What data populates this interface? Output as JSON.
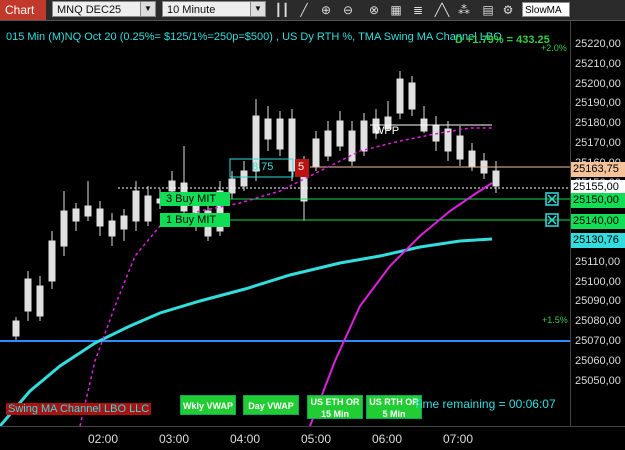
{
  "toolbar": {
    "tab_label": "Chart",
    "instrument": "MNQ DEC25",
    "interval": "10 Minute",
    "indicator_input": "SlowMA",
    "icons": [
      "bar-style-icon",
      "draw-line-icon",
      "zoom-in-icon",
      "zoom-out-icon",
      "crosshair-icon",
      "data-box-icon",
      "price-ladder-icon",
      "indicators-icon",
      "strategies-icon",
      "properties-icon"
    ]
  },
  "chart_title": "015 Min (M)NQ Oct 20 (0.25%= $125/1%=250p=$500) , US Dy RTH %, TMA Swing MA Channel LBO",
  "annotations": {
    "top_right_pct": "D +1.79% = 433.25",
    "pct_2": "+2.0%",
    "pct_15": "+1.5%",
    "wpp": "WPP",
    "qty_box": "8,75",
    "qty_red": "5",
    "order1": "3  Buy MIT",
    "order2": "1  Buy MIT",
    "bottom_left": "Swing MA Channel LBO LLC",
    "time_remaining": "Time remaining = 00:06:07"
  },
  "vwap_buttons": {
    "weekly": "Wkly VWAP",
    "day": "Day VWAP",
    "us_eth": "US ETH OR 15 Min",
    "us_rth": "US RTH OR 5 Min"
  },
  "price_axis": {
    "ticks": [
      "25220,00",
      "25210,00",
      "25200,00",
      "25190,00",
      "25180,00",
      "25170,00",
      "25160,00",
      "25150,00",
      "25140,00",
      "25130,00",
      "25120,00",
      "25110,00",
      "25100,00",
      "25090,00",
      "25080,00",
      "25070,00",
      "25060,00",
      "25050,00"
    ],
    "labels": [
      {
        "text": "25163,75",
        "bg": "#f5c29a",
        "fg": "#000"
      },
      {
        "text": "25155,00",
        "bg": "#ffffff",
        "fg": "#000"
      },
      {
        "text": "25150,00",
        "bg": "#11dd55",
        "fg": "#000"
      },
      {
        "text": "25140,00",
        "bg": "#11dd55",
        "fg": "#000"
      },
      {
        "text": "25130,76",
        "bg": "#33dddd",
        "fg": "#000"
      }
    ]
  },
  "time_axis": {
    "ticks": [
      "02:00",
      "03:00",
      "04:00",
      "05:00",
      "06:00",
      "07:00"
    ]
  },
  "colors": {
    "cyan": "#33dddd",
    "magenta": "#dd22dd",
    "blue_line": "#2a8cff",
    "candle": "#e0e0e0"
  }
}
